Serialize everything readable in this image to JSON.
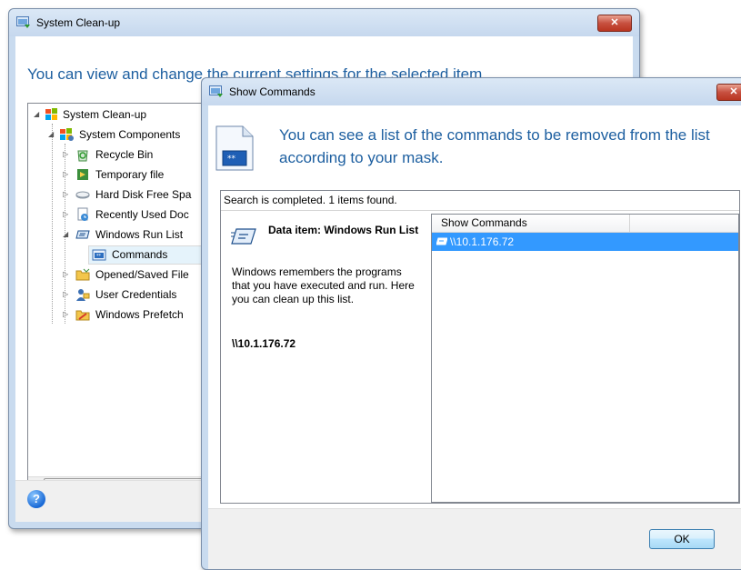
{
  "main_window": {
    "title": "System Clean-up",
    "close_label": "✕",
    "headline": "You can view and change the current settings for the selected item.",
    "tree": [
      {
        "label": "System Clean-up",
        "icon": "windows-logo-icon",
        "expander": "expanded"
      },
      {
        "label": "System Components",
        "icon": "components-icon",
        "expander": "expanded"
      },
      {
        "label": "Recycle Bin",
        "icon": "recycle-bin-icon",
        "expander": "collapsed"
      },
      {
        "label": "Temporary file",
        "icon": "temporary-file-icon",
        "expander": "collapsed"
      },
      {
        "label": "Hard Disk Free Spa",
        "icon": "hard-disk-icon",
        "expander": "collapsed"
      },
      {
        "label": "Recently Used Doc",
        "icon": "recent-documents-icon",
        "expander": "collapsed"
      },
      {
        "label": "Windows Run List",
        "icon": "run-list-icon",
        "expander": "expanded"
      },
      {
        "label": "Commands",
        "icon": "commands-icon",
        "expander": "none"
      },
      {
        "label": "Opened/Saved File",
        "icon": "folder-icon",
        "expander": "collapsed"
      },
      {
        "label": "User Credentials",
        "icon": "user-credentials-icon",
        "expander": "collapsed"
      },
      {
        "label": "Windows Prefetch",
        "icon": "prefetch-icon",
        "expander": "collapsed"
      }
    ],
    "scroll_thumb_grip": "|||",
    "help_label": "?"
  },
  "dialog": {
    "title": "Show Commands",
    "close_label": "✕",
    "headline": "You can see a list of the commands to be removed from the list according to your mask.",
    "status": "Search is completed. 1 items found.",
    "data_item_title": "Data item: Windows Run List",
    "data_item_description": "Windows remembers the programs that you have executed and run. Here you can clean up this list.",
    "data_item_value": "\\\\10.1.176.72",
    "list_header": "Show Commands",
    "list_rows": [
      "\\\\10.1.176.72"
    ],
    "ok_label": "OK"
  },
  "colors": {
    "headline_blue": "#1d5fa0",
    "selection_blue": "#3399ff",
    "window_frame": "#c9dbef"
  }
}
